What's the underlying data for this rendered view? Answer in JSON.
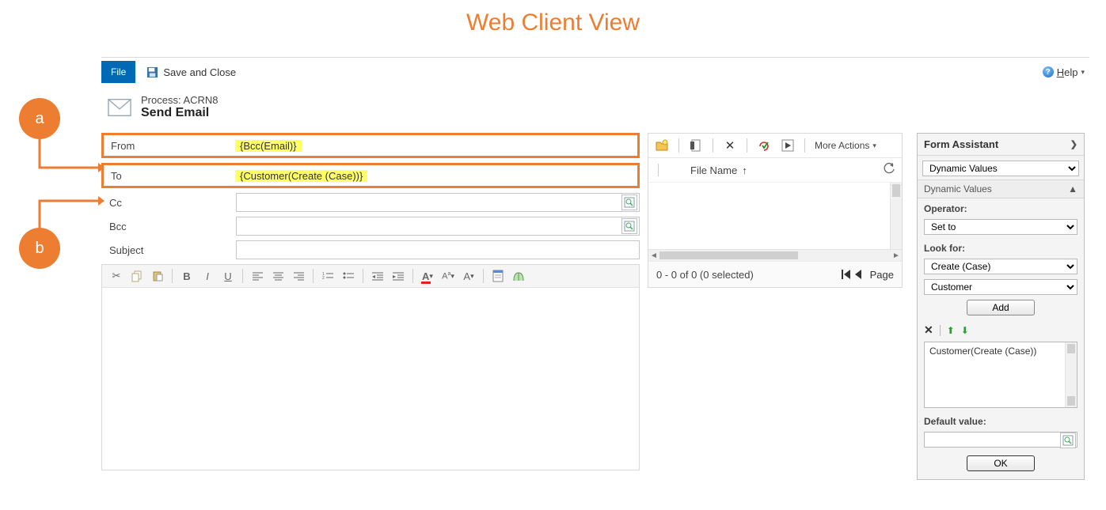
{
  "page_heading": "Web Client View",
  "callouts": {
    "a": "a",
    "b": "b"
  },
  "topbar": {
    "file": "File",
    "save_and_close": "Save and Close",
    "help": "Help"
  },
  "header": {
    "process_label": "Process: ACRN8",
    "title": "Send Email"
  },
  "fields": {
    "from": {
      "label": "From",
      "value": "{Bcc(Email)}"
    },
    "to": {
      "label": "To",
      "value": "{Customer(Create (Case))}"
    },
    "cc": {
      "label": "Cc",
      "value": ""
    },
    "bcc": {
      "label": "Bcc",
      "value": ""
    },
    "subject": {
      "label": "Subject",
      "value": ""
    }
  },
  "attachments": {
    "more_actions": "More Actions",
    "column": "File Name",
    "status": "0 - 0 of 0 (0 selected)",
    "page_label": "Page"
  },
  "form_assistant": {
    "title": "Form Assistant",
    "top_select": "Dynamic Values",
    "section": "Dynamic Values",
    "operator_label": "Operator:",
    "operator_value": "Set to",
    "lookfor_label": "Look for:",
    "lookfor_entity": "Create (Case)",
    "lookfor_field": "Customer",
    "add": "Add",
    "list_item": "Customer(Create (Case))",
    "default_label": "Default value:",
    "default_value": "",
    "ok": "OK"
  }
}
